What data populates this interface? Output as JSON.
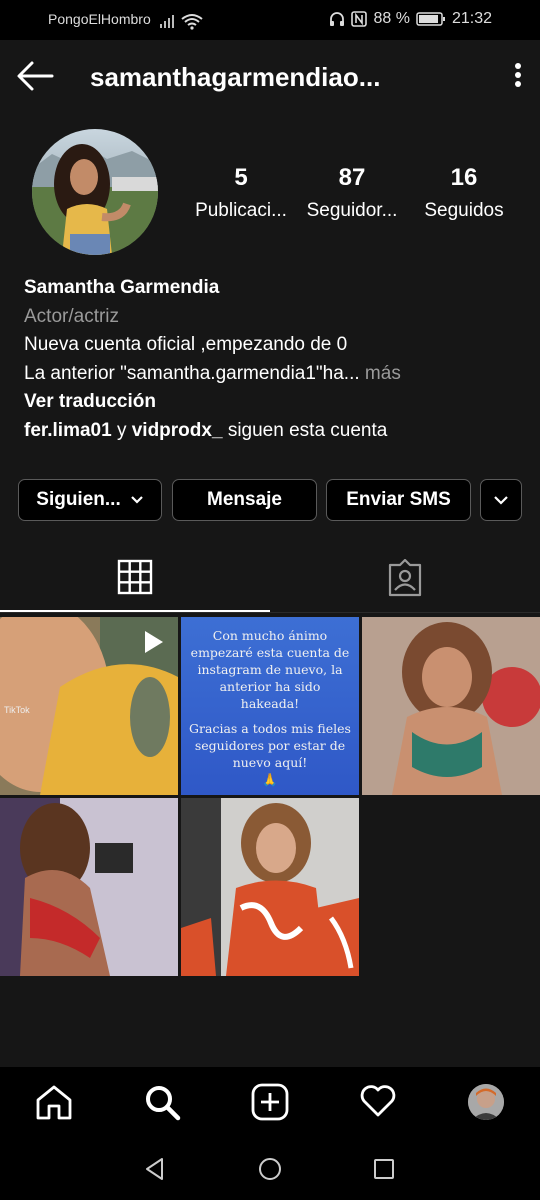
{
  "status": {
    "carrier": "PongoElHombro",
    "battery": "88 %",
    "time": "21:32"
  },
  "header": {
    "username": "samanthagarmendiao..."
  },
  "profile": {
    "posts_count": "5",
    "posts_label": "Publicaci...",
    "followers_count": "87",
    "followers_label": "Seguidor...",
    "following_count": "16",
    "following_label": "Seguidos",
    "name": "Samantha Garmendia",
    "category": "Actor/actriz",
    "bio_line1": "Nueva cuenta oficial ,empezando de 0",
    "bio_line2": "La anterior \"samantha.garmendia1\"ha...",
    "bio_more": "más",
    "translate": "Ver traducción",
    "mutual_user1": "fer.lima01",
    "mutual_and": "y",
    "mutual_user2": "vidprodx_",
    "mutual_suffix": "siguen esta cuenta"
  },
  "actions": {
    "following": "Siguien...",
    "message": "Mensaje",
    "sms": "Enviar SMS"
  },
  "posts": {
    "tile1_watermark": "TikTok",
    "tile2_text": "Con mucho ánimo empezaré esta cuenta de instagram de nuevo, la anterior ha sido hakeada! Gracias a todos mis fieles seguidores por estar de nuevo aquí!",
    "tile2_p1": "Con mucho ánimo empezaré esta cuenta de instagram de nuevo, la anterior ha sido hakeada!",
    "tile2_p2": "Gracias a todos mis fieles seguidores por estar de nuevo aquí!",
    "tile2_emoji": "🙏"
  },
  "icons": [
    "back-arrow-icon",
    "more-vertical-icon",
    "chevron-down-icon",
    "grid-icon",
    "tagged-icon",
    "play-icon",
    "home-icon",
    "search-icon",
    "add-icon",
    "heart-icon",
    "profile-avatar",
    "triangle-back-icon",
    "circle-home-icon",
    "square-recents-icon"
  ]
}
